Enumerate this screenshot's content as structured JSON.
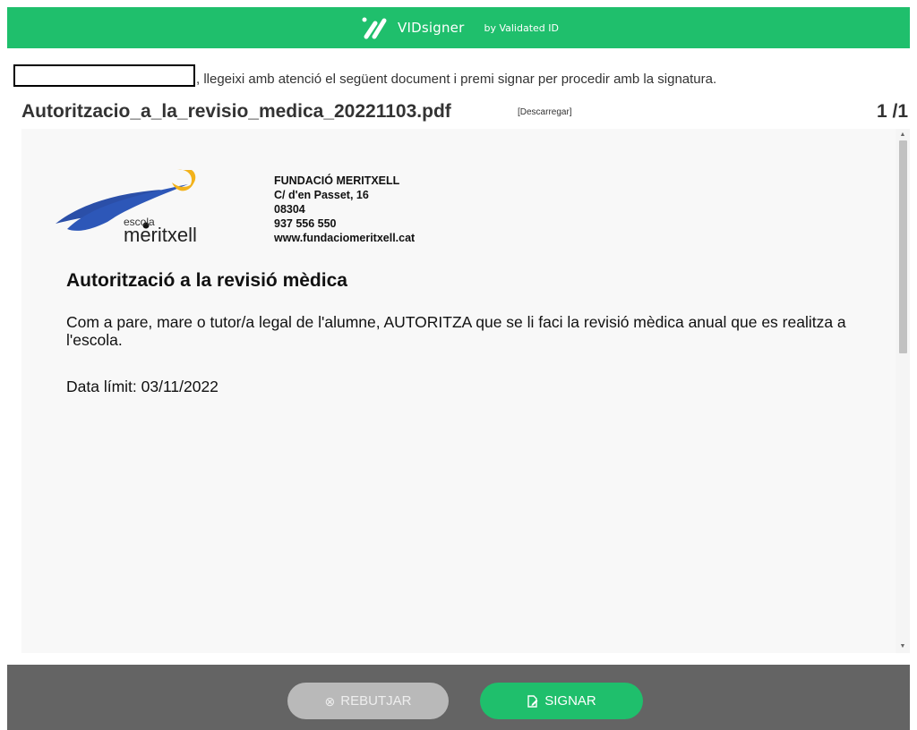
{
  "header": {
    "brand_name": "VIDsigner",
    "brand_by": "by Validated ID",
    "brand_color": "#1fbf6c"
  },
  "instruction": ", llegeixi amb atenció el següent document i premi signar per procedir amb la signatura.",
  "document": {
    "filename": "Autoritzacio_a_la_revisio_medica_20221103.pdf",
    "download_label": "[Descarregar]",
    "page_indicator": "1 /1"
  },
  "page": {
    "logo_small": "escola",
    "logo_name": "meritxell",
    "org": {
      "name": "FUNDACIÓ MERITXELL",
      "address": "C/ d'en Passet, 16",
      "postcode": "08304",
      "phone": "937 556 550",
      "web": "www.fundaciomeritxell.cat"
    },
    "heading": "Autorització a la revisió mèdica",
    "body": "Com a pare, mare o tutor/a legal de l'alumne,  AUTORITZA que se li faci la revisió mèdica anual que es realitza a l'escola.",
    "deadline": "Data límit: 03/11/2022"
  },
  "footer": {
    "reject_label": "REBUTJAR",
    "reject_icon": "circle-x-icon",
    "sign_label": "SIGNAR",
    "sign_icon": "sign-document-icon"
  }
}
